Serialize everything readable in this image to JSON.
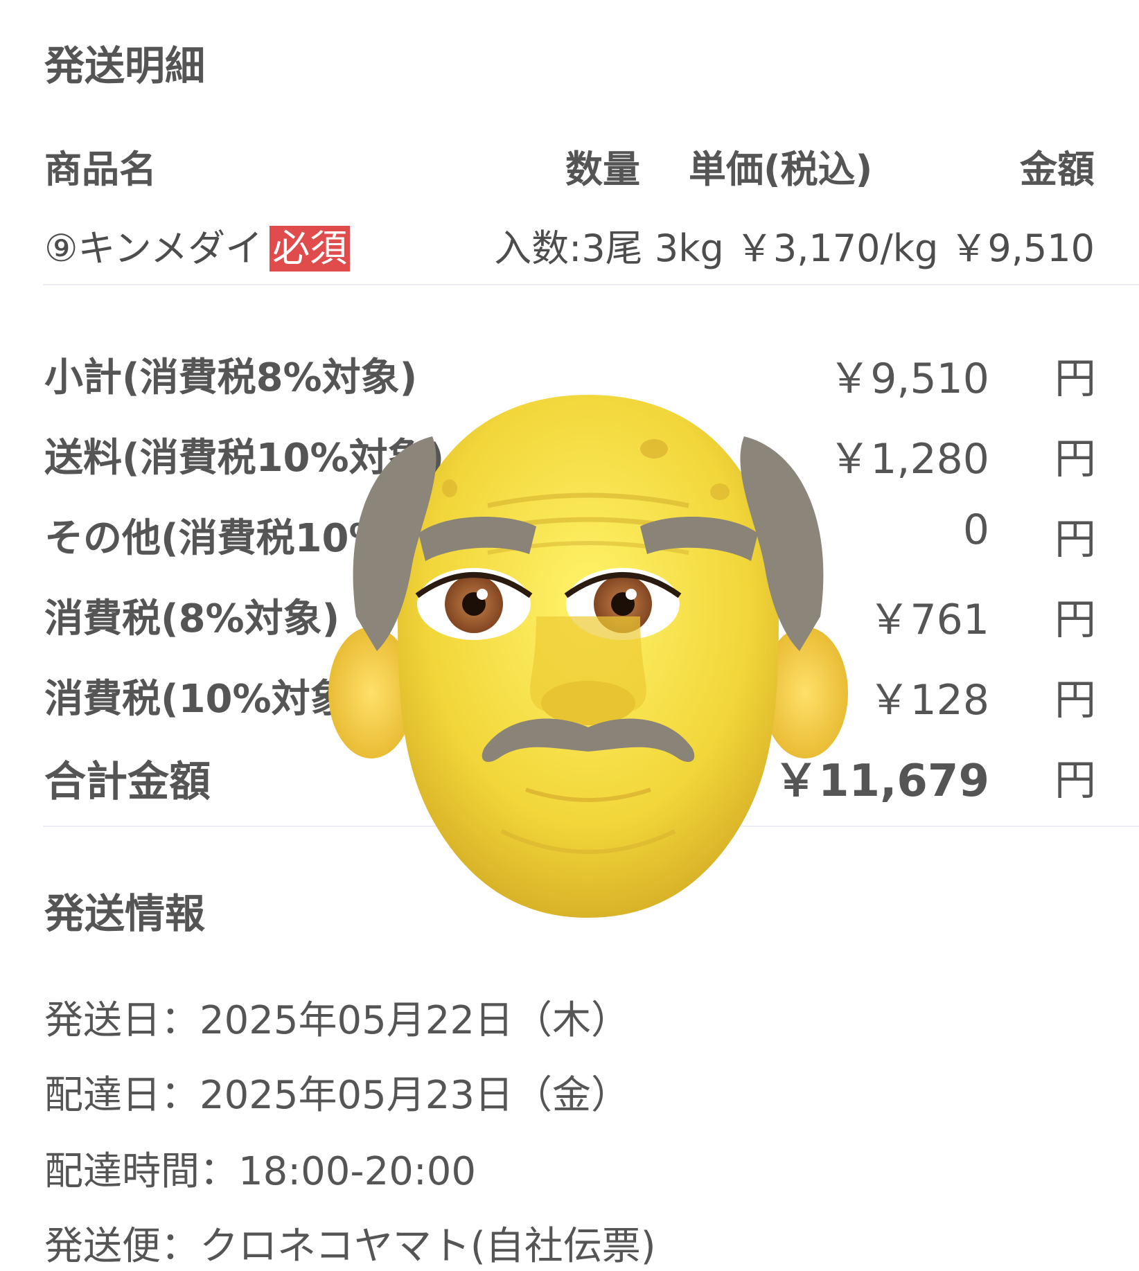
{
  "shipping_details": {
    "title": "発送明細",
    "columns": {
      "name": "商品名",
      "quantity": "数量",
      "unit_price": "単価(税込)",
      "amount": "金額"
    },
    "item": {
      "name": "⑨キンメダイ",
      "badge": "必須",
      "detail": "入数:3尾 3kg ￥3,170/kg ￥9,510"
    }
  },
  "summary": [
    {
      "label": "小計(消費税8%対象)",
      "value": "￥9,510",
      "unit": "円"
    },
    {
      "label": "送料(消費税10%対象)",
      "value": "￥1,280",
      "unit": "円"
    },
    {
      "label": "その他(消費税10%対象)",
      "value": "0",
      "unit": "円"
    },
    {
      "label": "消費税(8%対象)",
      "value": "￥761",
      "unit": "円"
    },
    {
      "label": "消費税(10%対象)",
      "value": "￥128",
      "unit": "円"
    },
    {
      "label": "合計金額",
      "value": "￥11,679",
      "unit": "円"
    }
  ],
  "shipping_info": {
    "title": "発送情報",
    "ship_date": "発送日：2025年05月22日（木）",
    "delivery_date": "配達日：2025年05月23日（金）",
    "delivery_time": "配達時間：18:00-20:00",
    "carrier": "発送便：クロネコヤマト(自社伝票)"
  },
  "overlay": {
    "icon": "old-man-memoji-icon"
  },
  "colors": {
    "badge": "#e04b4b",
    "text": "#555555",
    "divider": "#ececf4"
  }
}
